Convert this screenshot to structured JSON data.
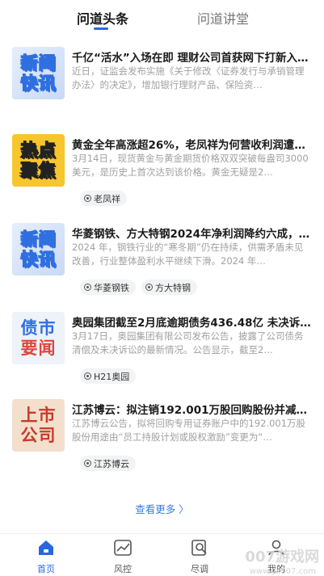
{
  "tabs": [
    {
      "label": "问道头条"
    },
    {
      "label": "问道讲堂"
    }
  ],
  "colors": {
    "accent": "#2a66e0",
    "more": "#3a7ae8"
  },
  "articles": [
    {
      "thumb_lines": [
        "新闻",
        "快讯"
      ],
      "title": "千亿“活水”入场在即 理财公司首获网下打新入…",
      "summary": "近日，证监会发布实施《关于修改〈证券发行与承销管理办法〉的决定》，增加银行理财产品、保险资…",
      "tags": []
    },
    {
      "thumb_lines": [
        "热点",
        "聚焦"
      ],
      "title": "黄金全年高涨超26%，老凤祥为何营收利润遭遇…",
      "summary": "3月14日，现货黄金与黄金期货价格双双突破每盎司3000美元，是历史上首次达到该价格。黄金无疑是2…",
      "tags": [
        "老凤祥"
      ]
    },
    {
      "thumb_lines": [
        "新闻",
        "快讯"
      ],
      "title": "华菱钢铁、方大特钢2024年净利润降约六成，…",
      "summary": "2024 年，钢铁行业的“寒冬期”仍在持续，供需矛盾未见改善，行业整体盈利水平继续下滑。2024 年…",
      "tags": [
        "华菱钢铁",
        "方大特钢"
      ]
    },
    {
      "thumb_lines": [
        "债市",
        "要闻"
      ],
      "title": "奥园集团截至2月底逾期债务436.48亿 未决诉…",
      "summary": "3月17日，奥园集团有限公司发布公告，披露了公司债务清偿及未决诉讼的最新情况。公告显示，截至2…",
      "tags": [
        "H21奥园"
      ]
    },
    {
      "thumb_lines": [
        "上市",
        "公司"
      ],
      "title": "江苏博云：拟注销192.001万股回购股份并减少…",
      "summary": "江苏博云公告，拟将回购专用证券账户中的192.001万股股份用途由“员工持股计划或股权激励”变更为“…",
      "tags": [
        "江苏博云"
      ]
    }
  ],
  "more_label": "查看更多 〉",
  "nav": [
    {
      "label": "首页",
      "icon": "home-icon"
    },
    {
      "label": "风控",
      "icon": "risk-chart-icon"
    },
    {
      "label": "尽调",
      "icon": "search-doc-icon"
    },
    {
      "label": "我的",
      "icon": "profile-icon"
    }
  ],
  "watermark": {
    "main": "007游戏网",
    "sub": "www.yx007.com"
  }
}
